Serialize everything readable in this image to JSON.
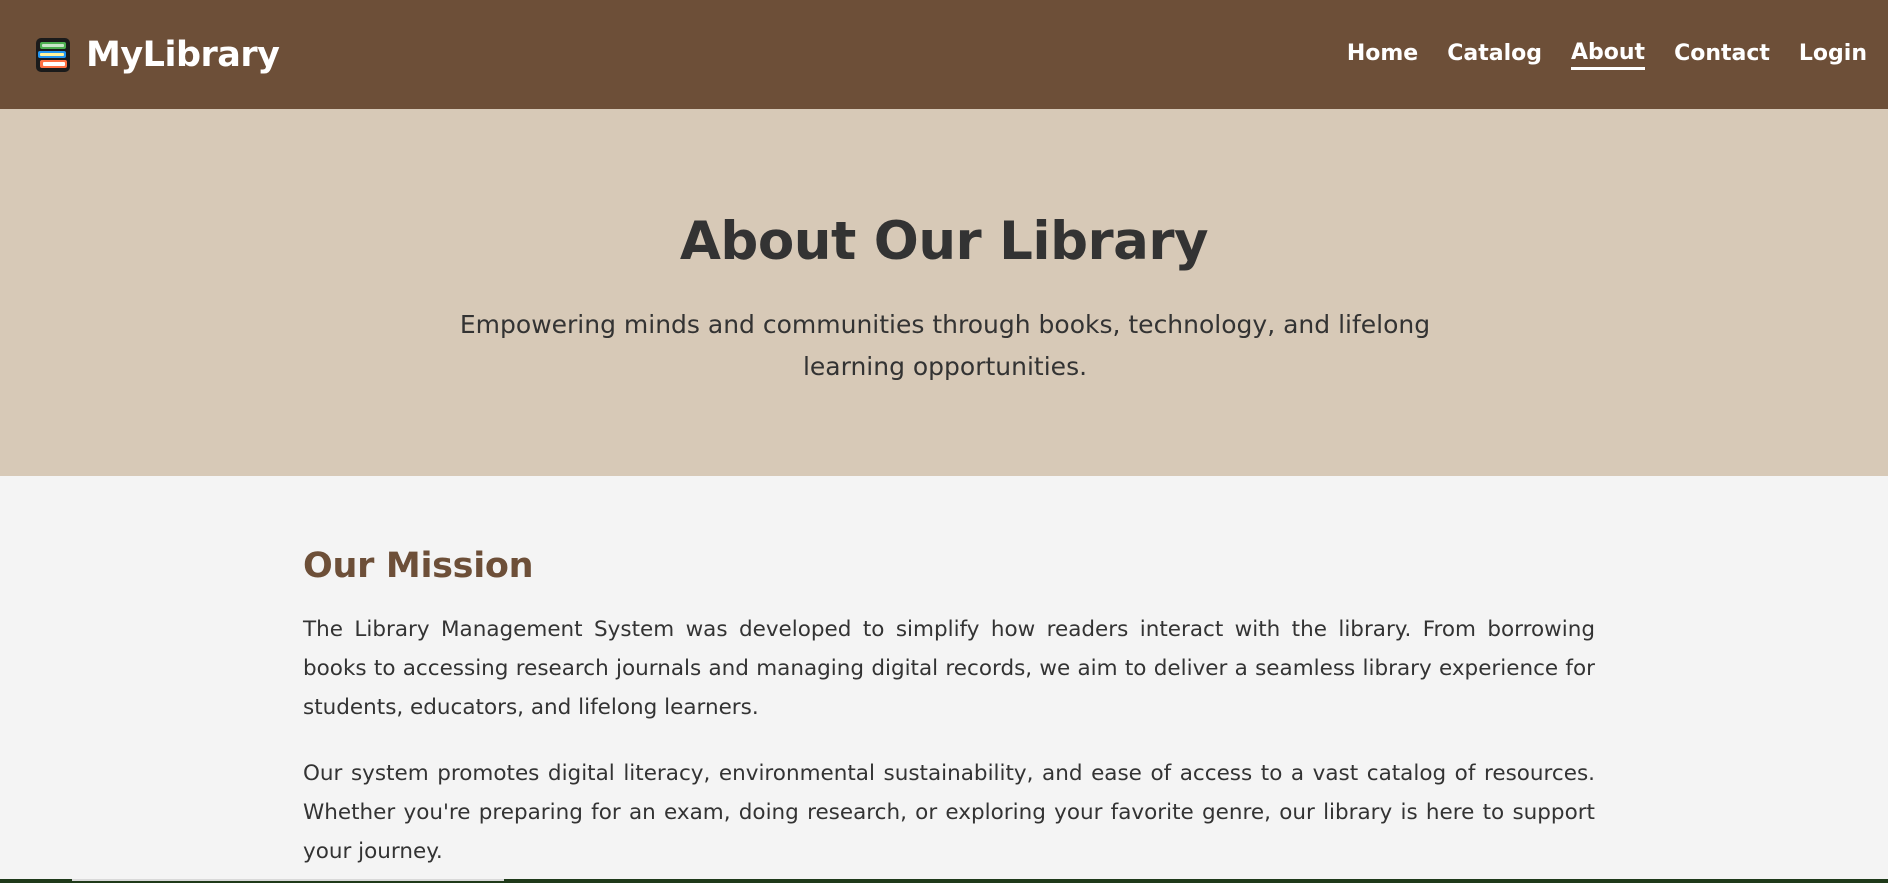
{
  "navbar": {
    "brand_name": "MyLibrary",
    "brand_icon": "books-stack-icon",
    "links": [
      {
        "label": "Home",
        "active": false
      },
      {
        "label": "Catalog",
        "active": false
      },
      {
        "label": "About",
        "active": true
      },
      {
        "label": "Contact",
        "active": false
      },
      {
        "label": "Login",
        "active": false
      }
    ],
    "background_color": "#6d4f38"
  },
  "hero": {
    "title": "About Our Library",
    "subtitle": "Empowering minds and communities through books, technology, and lifelong learning opportunities.",
    "background_color": "#d7c9b7"
  },
  "mission": {
    "heading": "Our Mission",
    "paragraphs": [
      "The Library Management System was developed to simplify how readers interact with the library. From borrowing books to accessing research journals and managing digital records, we aim to deliver a seamless library experience for students, educators, and lifelong learners.",
      "Our system promotes digital literacy, environmental sustainability, and ease of access to a vast catalog of resources. Whether you're preparing for an exam, doing research, or exploring your favorite genre, our library is here to support your journey."
    ],
    "heading_color": "#6d4f38"
  }
}
